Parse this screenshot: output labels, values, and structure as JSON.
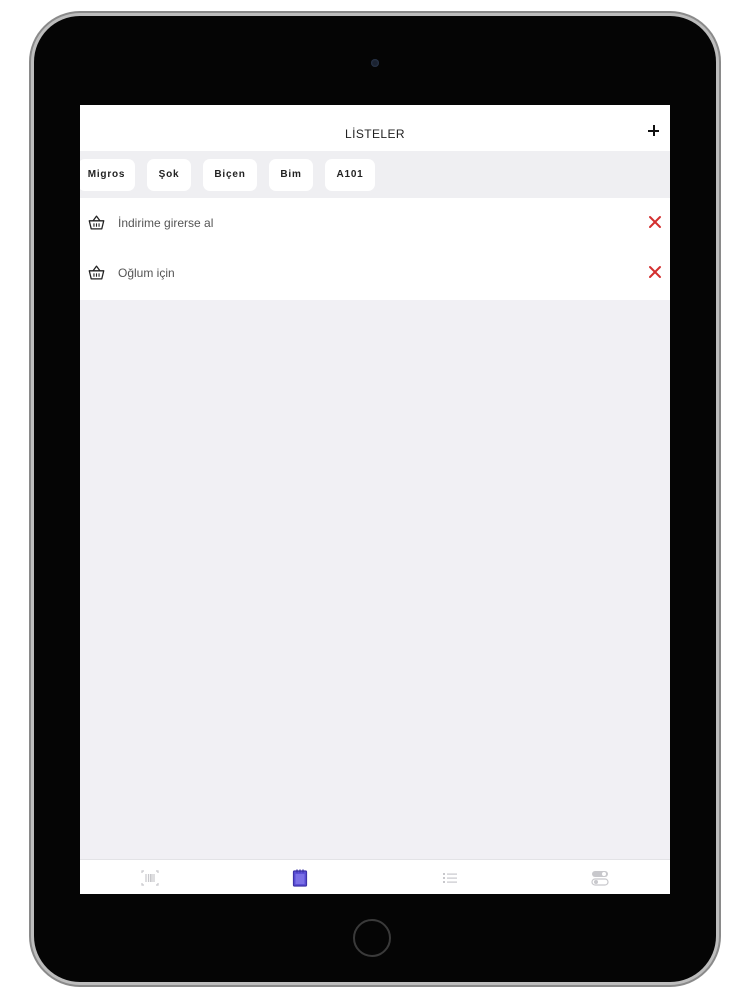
{
  "header": {
    "title": "LİSTELER",
    "add_icon": "plus-icon"
  },
  "stores": [
    {
      "label": "Migros"
    },
    {
      "label": "Şok"
    },
    {
      "label": "Biçen"
    },
    {
      "label": "Bim"
    },
    {
      "label": "A101"
    }
  ],
  "lists": [
    {
      "label": "İndirime girerse al",
      "icon": "basket-icon",
      "action_icon": "close-icon"
    },
    {
      "label": "Oğlum için",
      "icon": "basket-icon",
      "action_icon": "close-icon"
    }
  ],
  "tabbar": {
    "tabs": [
      {
        "icon": "barcode-icon",
        "active": false
      },
      {
        "icon": "notepad-icon",
        "active": true
      },
      {
        "icon": "list-icon",
        "active": false
      },
      {
        "icon": "settings-toggle-icon",
        "active": false
      }
    ],
    "active_color": "#5b4fd6",
    "inactive_color": "#c8c8cc"
  },
  "colors": {
    "delete": "#d32f2f",
    "background": "#f1f0f4"
  }
}
